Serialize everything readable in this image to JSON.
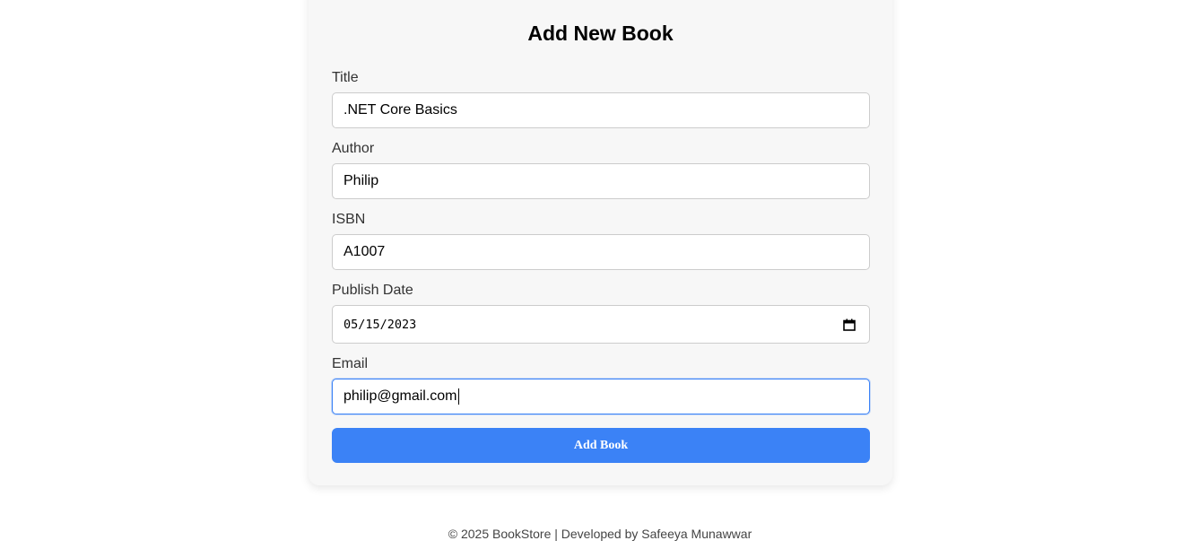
{
  "form": {
    "title": "Add New Book",
    "fields": [
      {
        "label": "Title",
        "value": ".NET Core Basics"
      },
      {
        "label": "Author",
        "value": "Philip"
      },
      {
        "label": "ISBN",
        "value": "A1007"
      },
      {
        "label": "Publish Date",
        "value": "05/15/2023"
      },
      {
        "label": "Email",
        "value": "philip@gmail.com"
      }
    ],
    "submit_label": "Add Book"
  },
  "footer": {
    "text": "© 2025 BookStore | Developed by Safeeya Munawwar"
  },
  "colors": {
    "accent": "#3b82f6",
    "card_background": "#f7f7f7"
  },
  "icons": {
    "date_picker": "calendar-icon"
  }
}
